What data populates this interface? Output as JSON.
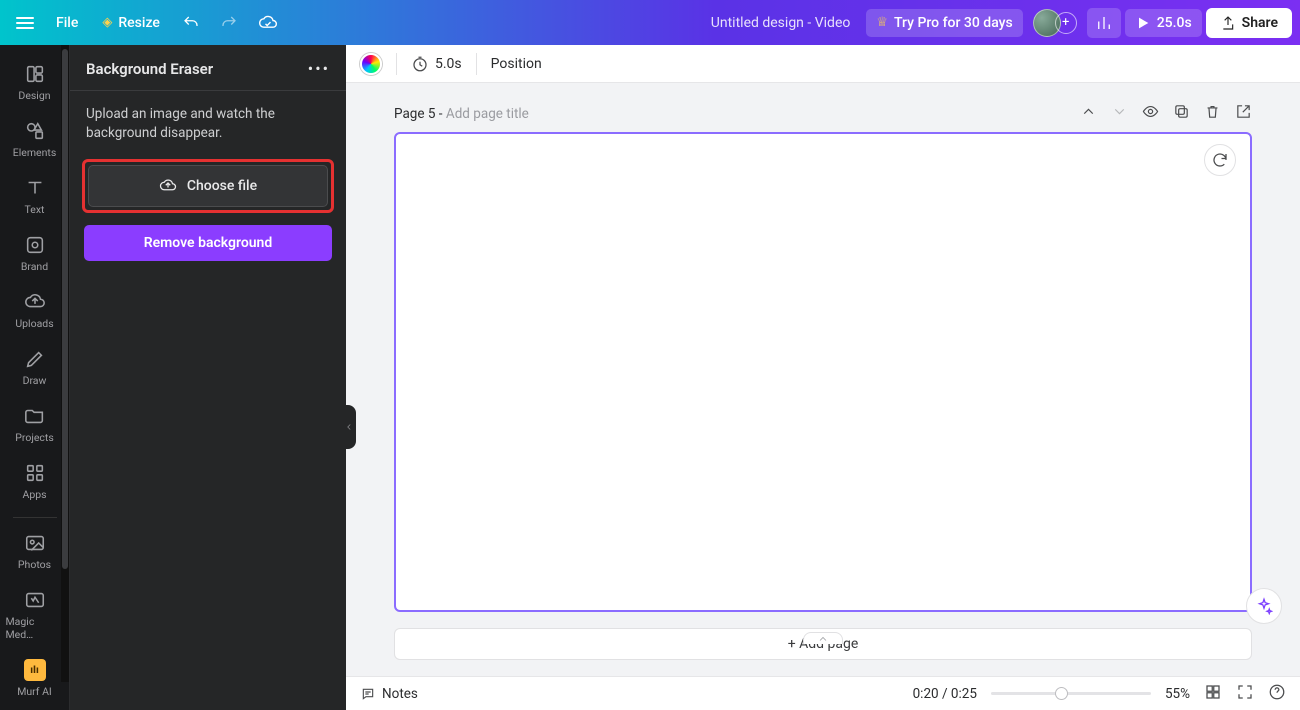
{
  "topbar": {
    "file": "File",
    "resize": "Resize",
    "doc_title": "Untitled design - Video",
    "try_pro": "Try Pro for 30 days",
    "play_time": "25.0s",
    "share": "Share"
  },
  "rail": {
    "design": "Design",
    "elements": "Elements",
    "text": "Text",
    "brand": "Brand",
    "uploads": "Uploads",
    "draw": "Draw",
    "projects": "Projects",
    "apps": "Apps",
    "photos": "Photos",
    "magic": "Magic Med…",
    "murf": "Murf AI"
  },
  "panel": {
    "title": "Background Eraser",
    "desc": "Upload an image and watch the background disappear.",
    "choose_label": "Choose file",
    "remove_label": "Remove background"
  },
  "toolbar": {
    "duration": "5.0s",
    "position": "Position"
  },
  "page": {
    "prefix": "Page 5 - ",
    "placeholder": "Add page title",
    "add_page": "+ Add page"
  },
  "bottom": {
    "notes": "Notes",
    "time": "0:20 / 0:25",
    "zoom": "55%"
  }
}
